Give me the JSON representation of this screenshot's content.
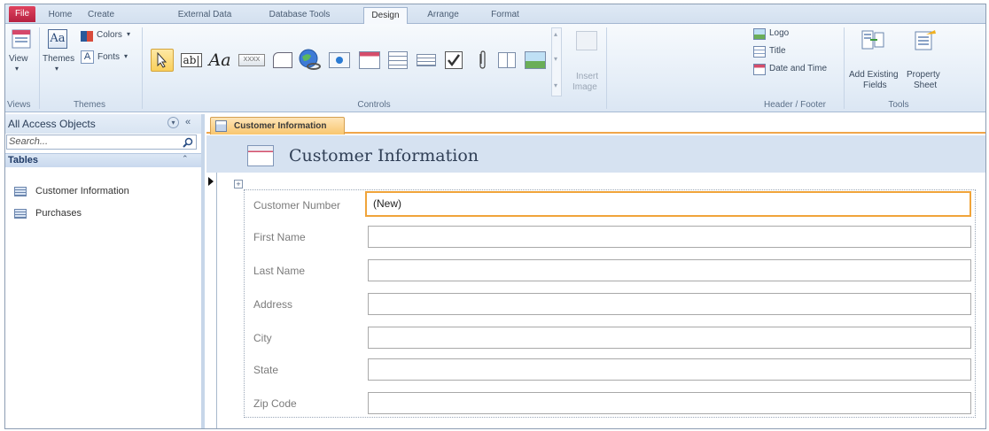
{
  "ribbon_tabs": [
    "File",
    "Home",
    "Create",
    "External Data",
    "Database Tools",
    "Design",
    "Arrange",
    "Format"
  ],
  "active_tab": "Design",
  "views": {
    "view_label": "View",
    "group_label": "Views"
  },
  "themes": {
    "themes_label": "Themes",
    "colors_label": "Colors",
    "fonts_label": "Fonts",
    "group_label": "Themes"
  },
  "controls": {
    "group_label": "Controls",
    "insert_image_line1": "Insert",
    "insert_image_line2": "Image"
  },
  "header_footer": {
    "logo": "Logo",
    "title": "Title",
    "date_time": "Date and Time",
    "group_label": "Header / Footer"
  },
  "tools": {
    "add_fields_line1": "Add Existing",
    "add_fields_line2": "Fields",
    "property_line1": "Property",
    "property_line2": "Sheet",
    "group_label": "Tools"
  },
  "nav_pane": {
    "title": "All Access Objects",
    "search_placeholder": "Search...",
    "section": "Tables",
    "items": [
      "Customer Information",
      "Purchases"
    ]
  },
  "document": {
    "tab_label": "Customer Information",
    "form_title": "Customer Information"
  },
  "form_fields": [
    {
      "label": "Customer Number",
      "value": "(New)"
    },
    {
      "label": "First Name",
      "value": ""
    },
    {
      "label": "Last Name",
      "value": ""
    },
    {
      "label": "Address",
      "value": ""
    },
    {
      "label": "City",
      "value": ""
    },
    {
      "label": "State",
      "value": ""
    },
    {
      "label": "Zip Code",
      "value": ""
    }
  ],
  "colors": {
    "file_tab": "#c8304f",
    "focus_border": "#f0a43a",
    "header_band": "#d6e2f1"
  }
}
